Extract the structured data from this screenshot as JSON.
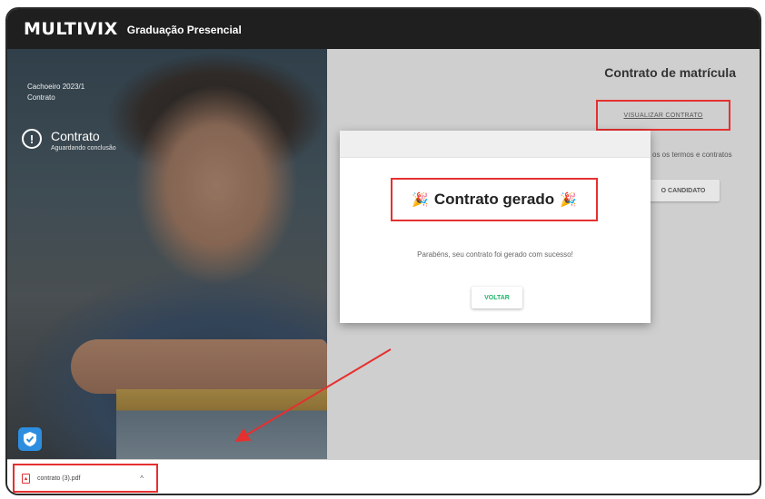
{
  "header": {
    "brand": "MULTIVIX",
    "subtitle": "Graduação Presencial"
  },
  "left": {
    "semester": "Cachoeiro 2023/1",
    "semester_sub": "Contrato",
    "status_title": "Contrato",
    "status_sub": "Aguardando conclusão",
    "alert_glyph": "!"
  },
  "right": {
    "title": "Contrato de matrícula",
    "view_link": "VISUALIZAR CONTRATO",
    "terms_text": "os os termos e contratos",
    "candidate_btn": "O CANDIDATO"
  },
  "modal": {
    "title": "Contrato gerado",
    "party_icon": "🎉",
    "message": "Parabéns, seu contrato foi gerado com sucesso!",
    "back_button": "VOLTAR"
  },
  "download": {
    "filename": "contrato (3).pdf",
    "caret": "^"
  },
  "colors": {
    "highlight": "#e53030",
    "accent_green": "#1db46a",
    "topbar": "#1f1f1f",
    "shield": "#2d8ee0"
  }
}
